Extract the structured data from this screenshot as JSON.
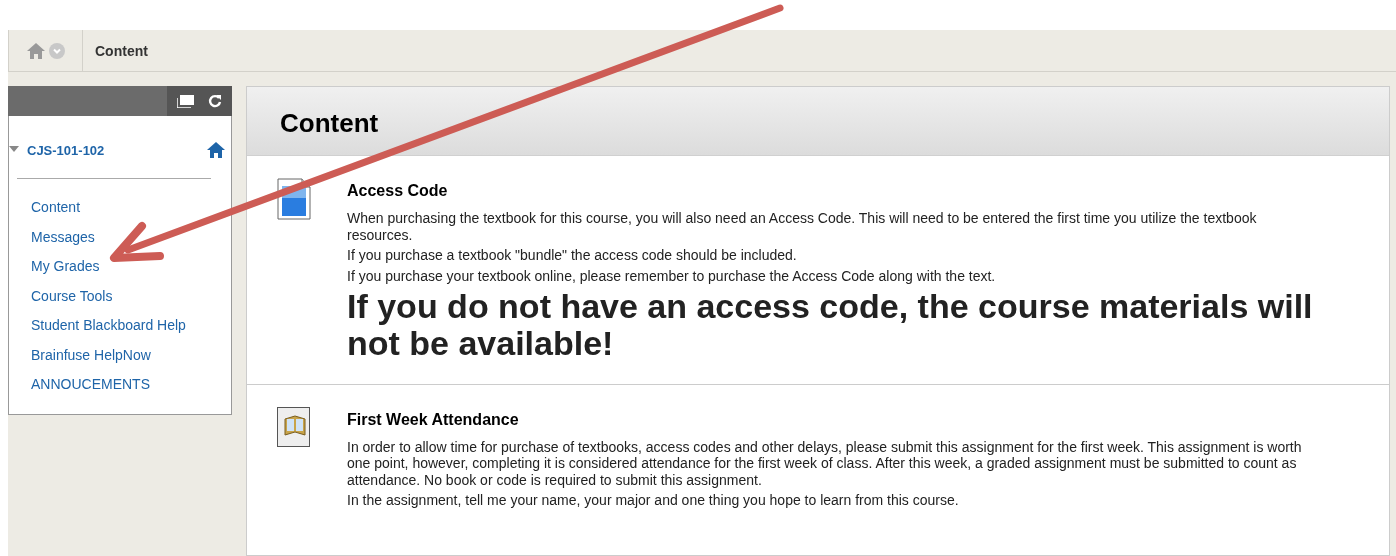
{
  "breadcrumb": {
    "current": "Content"
  },
  "course_menu": {
    "course": "CJS-101-102",
    "expanded": true,
    "items": [
      {
        "label": "Content"
      },
      {
        "label": "Messages"
      },
      {
        "label": "My Grades"
      },
      {
        "label": "Course Tools"
      },
      {
        "label": "Student Blackboard Help"
      },
      {
        "label": "Brainfuse HelpNow"
      },
      {
        "label": "ANNOUCEMENTS"
      }
    ]
  },
  "page": {
    "title": "Content",
    "items": [
      {
        "kind": "document",
        "title": "Access Code",
        "paragraphs": [
          {
            "kind": "normal",
            "text": "When purchasing the textbook for this course, you will also need an Access Code. This will need to be entered the first time you utilize the textbook resources."
          },
          {
            "kind": "normal",
            "text": "If you purchase a textbook \"bundle\" the access code should be included."
          },
          {
            "kind": "normal",
            "text": "If you purchase your textbook online, please remember to purchase the Access Code along with the text."
          },
          {
            "kind": "large",
            "text": "If you do not have an access code, the course materials will not be available!"
          }
        ]
      },
      {
        "kind": "assignment",
        "title": "First Week Attendance",
        "paragraphs": [
          {
            "kind": "normal",
            "text": "In order to allow time for purchase of textbooks, access codes and other delays, please submit this assignment for the first week. This assignment is worth one point, however, completing it is considered attendance for the first week of class. After this week, a graded assignment must be submitted to count as attendance. No book or code is required to submit this assignment."
          },
          {
            "kind": "normal",
            "text": "In the assignment, tell me your name, your major and one thing you hope to learn from this course."
          }
        ]
      }
    ]
  }
}
